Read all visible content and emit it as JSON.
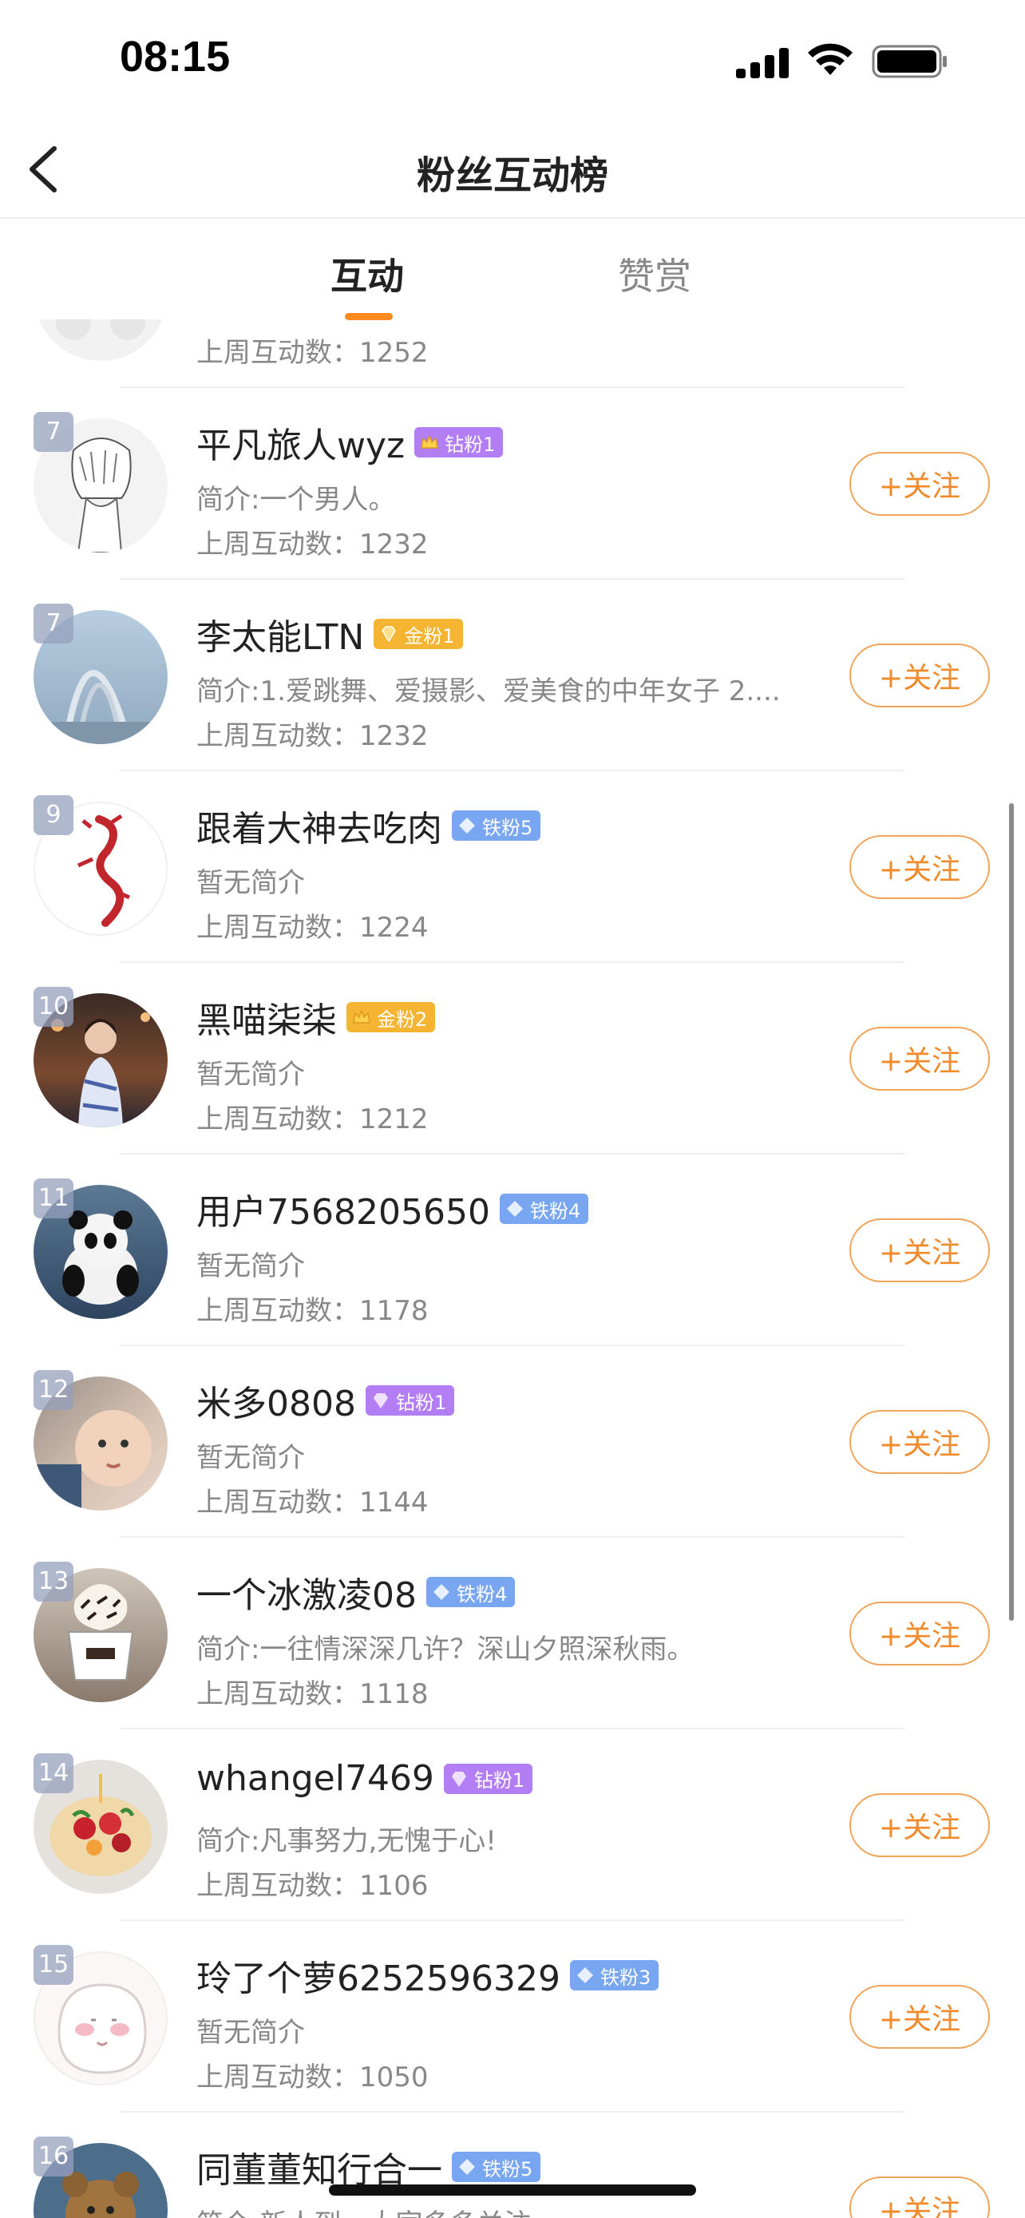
{
  "status": {
    "time": "08:15"
  },
  "nav": {
    "title": "粉丝互动榜"
  },
  "tabs": [
    {
      "label": "互动",
      "active": true
    },
    {
      "label": "赞赏",
      "active": false
    }
  ],
  "colors": {
    "accent": "#ff8a1f",
    "diamond": "#b37ef4",
    "gold": "#f5b431",
    "iron": "#78a6f0"
  },
  "partial_row": {
    "count": "上周互动数：1252"
  },
  "follow_label": "+关注",
  "rows": [
    {
      "rank": "7",
      "name": "平凡旅人wyz",
      "badge": "钻粉1",
      "badge_type": "gold-crown",
      "bio": "简介:一个男人。",
      "count": "上周互动数：1232",
      "avatar": "sketch-boy"
    },
    {
      "rank": "7",
      "name": "李太能LTN",
      "badge": "金粉1",
      "badge_type": "gold",
      "bio": "简介:1.爱跳舞、爱摄影、爱美食的中年女子 2....",
      "count": "上周互动数：1232",
      "avatar": "arch-bridge"
    },
    {
      "rank": "9",
      "name": "跟着大神去吃肉",
      "badge": "铁粉5",
      "badge_type": "iron",
      "bio": "暂无简介",
      "count": "上周互动数：1224",
      "avatar": "red-dragon"
    },
    {
      "rank": "10",
      "name": "黑喵柒柒",
      "badge": "金粉2",
      "badge_type": "gold-crown",
      "bio": "暂无简介",
      "count": "上周互动数：1212",
      "avatar": "woman-night"
    },
    {
      "rank": "11",
      "name": "用户7568205650",
      "badge": "铁粉4",
      "badge_type": "iron",
      "bio": "暂无简介",
      "count": "上周互动数：1178",
      "avatar": "panda"
    },
    {
      "rank": "12",
      "name": "米多0808",
      "badge": "钻粉1",
      "badge_type": "diamond",
      "bio": "暂无简介",
      "count": "上周互动数：1144",
      "avatar": "baby"
    },
    {
      "rank": "13",
      "name": "一个冰激凌08",
      "badge": "铁粉4",
      "badge_type": "iron",
      "bio": "简介:一往情深深几许？深山夕照深秋雨。",
      "count": "上周互动数：1118",
      "avatar": "coffee"
    },
    {
      "rank": "14",
      "name": "whangel7469",
      "badge": "钻粉1",
      "badge_type": "diamond",
      "bio": "简介:凡事努力,无愧于心!",
      "count": "上周互动数：1106",
      "avatar": "cake"
    },
    {
      "rank": "15",
      "name": "玲了个萝6252596329",
      "badge": "铁粉3",
      "badge_type": "iron",
      "bio": "暂无简介",
      "count": "上周互动数：1050",
      "avatar": "cartoon-face"
    },
    {
      "rank": "16",
      "name": "同董董知行合一",
      "badge": "铁粉5",
      "badge_type": "iron",
      "bio": "简介:新人到，大家多多关注",
      "count": "",
      "avatar": "teddy-bear"
    }
  ]
}
